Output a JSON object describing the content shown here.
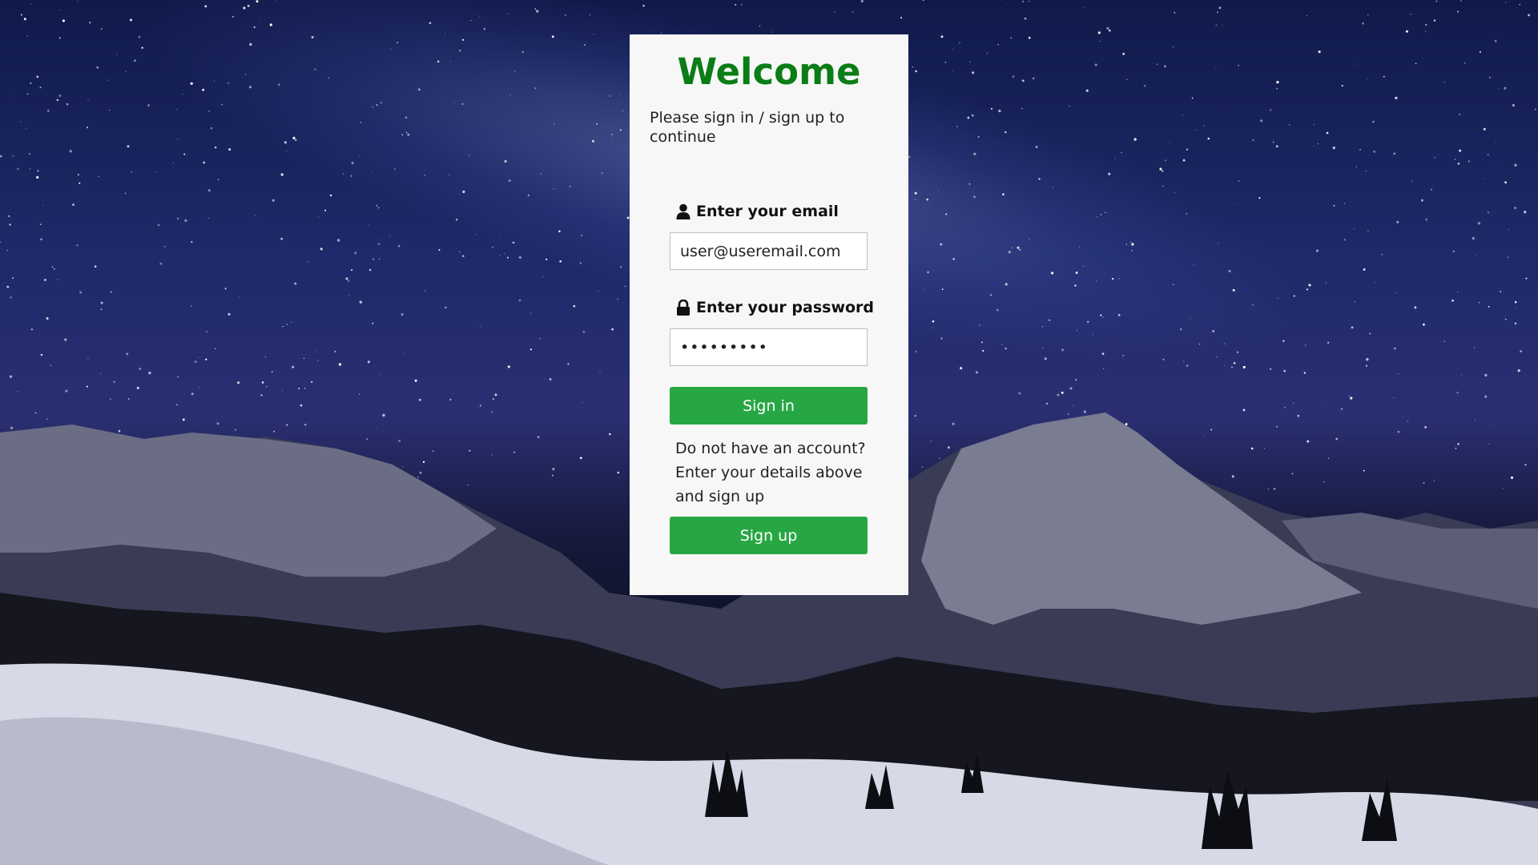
{
  "card": {
    "title": "Welcome",
    "subtitle": "Please sign in / sign up to continue"
  },
  "email": {
    "label": "Enter your email",
    "value": "user@useremail.com",
    "icon": "user-icon"
  },
  "password": {
    "label": "Enter your password",
    "value": "•••••••••",
    "icon": "lock-icon"
  },
  "buttons": {
    "sign_in": "Sign in",
    "sign_up": "Sign up"
  },
  "signup_hint": "Do not have an account? Enter your details above and sign up",
  "colors": {
    "title": "#0b7d16",
    "button": "#27a744",
    "card": "#f7f7f7"
  }
}
